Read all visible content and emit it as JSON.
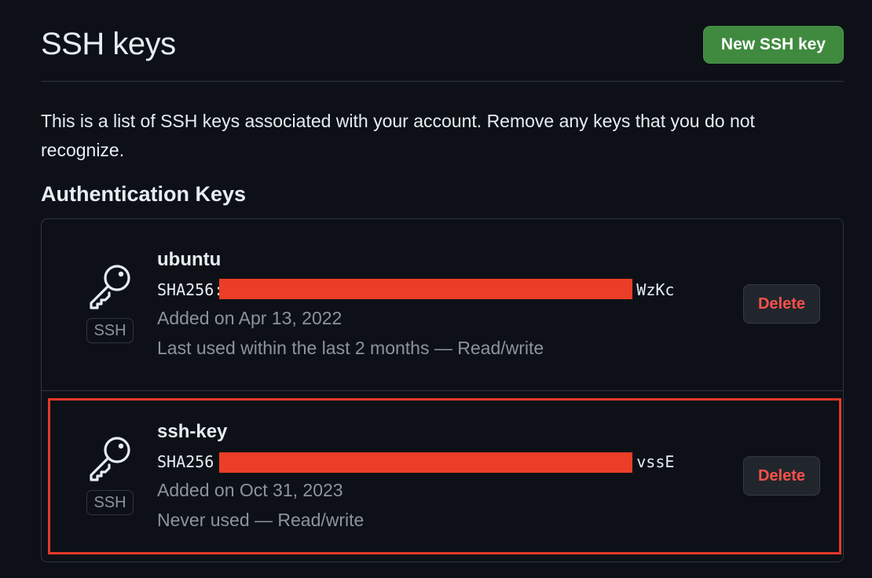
{
  "header": {
    "title": "SSH keys",
    "new_button_label": "New SSH key"
  },
  "description": "This is a list of SSH keys associated with your account. Remove any keys that you do not recognize.",
  "section_title": "Authentication Keys",
  "keys": [
    {
      "title": "ubuntu",
      "fingerprint": "SHA256:",
      "fingerprint_tail": "WzKc",
      "badge": "SSH",
      "added": "Added on Apr 13, 2022",
      "last_used": "Last used within the last 2 months — Read/write",
      "delete_label": "Delete",
      "icon": "key-icon"
    },
    {
      "title": "ssh-key",
      "fingerprint": "SHA256",
      "fingerprint_tail": "vssE",
      "badge": "SSH",
      "added": "Added on Oct 31, 2023",
      "last_used": "Never used — Read/write",
      "delete_label": "Delete",
      "icon": "key-icon"
    }
  ],
  "colors": {
    "background": "#0d1117",
    "primary_button": "#3f8a3f",
    "danger_text": "#f85149",
    "redaction": "#ea3e26",
    "highlight": "#e5392a"
  }
}
